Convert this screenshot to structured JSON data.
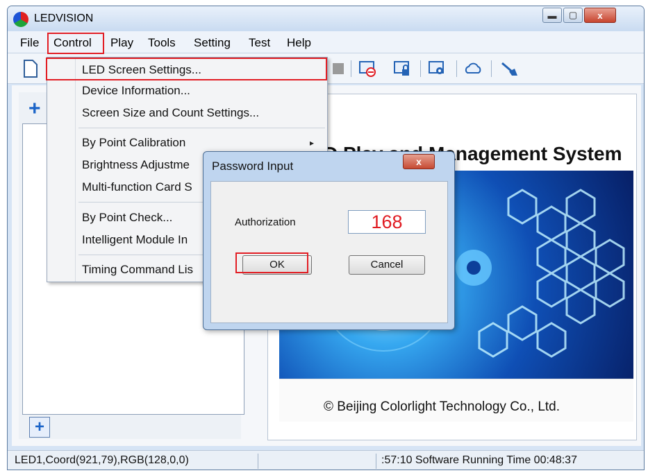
{
  "window": {
    "title": "LEDVISION",
    "minimize_icon": "minimize-icon",
    "maximize_icon": "maximize-icon",
    "close_glyph": "x"
  },
  "menubar": {
    "items": [
      "File",
      "Control",
      "Play",
      "Tools",
      "Setting",
      "Test",
      "Help"
    ],
    "highlighted": "Control"
  },
  "control_menu": {
    "items": [
      "LED Screen Settings...",
      "Device Information...",
      "Screen Size and Count Settings...",
      "By Point Calibration",
      "Brightness Adjustme",
      "Multi-function Card S",
      "By Point Check...",
      "Intelligent Module In",
      "Timing Command Lis"
    ],
    "submenu_arrow": "▸",
    "highlighted": "LED Screen Settings..."
  },
  "toolbar": {
    "icons": [
      "new-document-icon",
      "stop-icon",
      "screen-off-icon",
      "screen-lock-icon",
      "settings-screen-icon",
      "cloud-icon",
      "broom-icon"
    ]
  },
  "left_panel": {
    "add_top_glyph": "+",
    "add_bottom_glyph": "+"
  },
  "banner": {
    "title": "D Play and Management System",
    "copyright": "© Beijing Colorlight Technology Co., Ltd."
  },
  "dialog": {
    "title": "Password Input",
    "close_glyph": "x",
    "auth_label": "Authorization",
    "auth_value": "168",
    "ok_label": "OK",
    "cancel_label": "Cancel"
  },
  "statusbar": {
    "left": "LED1,Coord(921,79),RGB(128,0,0)",
    "right": ":57:10 Software Running Time 00:48:37"
  },
  "colors": {
    "highlight_border": "#e21d24",
    "auth_text": "#e01b22",
    "accent_blue": "#1b64c8"
  }
}
